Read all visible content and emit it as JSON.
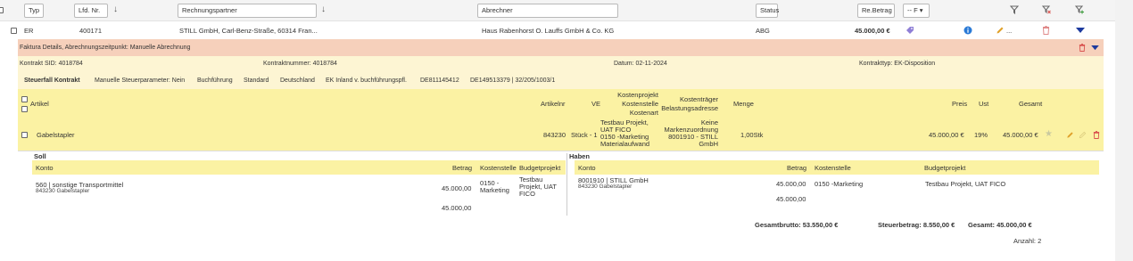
{
  "filters": {
    "typ": "Typ",
    "lfd_nr": "Lfd. Nr.",
    "rechnungspartner": "Rechnungspartner",
    "abrechner": "Abrechner",
    "status": "Status",
    "re_betrag": "Re.Betrag",
    "select_value": "-- F"
  },
  "row": {
    "typ": "ER",
    "lfd_nr": "400171",
    "rechnungspartner": "STILL GmbH, Carl-Benz-Straße, 60314 Fran...",
    "abrechner": "Haus Rabenhorst O. Lauffs GmbH & Co. KG",
    "status": "ABG",
    "betrag": "45.000,00 €",
    "more": "..."
  },
  "detail": {
    "header": "Faktura Details, Abrechnungszeitpunkt: Manuelle Abrechnung",
    "kontrakt_sid": "Kontrakt SID: 4018784",
    "kontraktnummer": "Kontraktnummer: 4018784",
    "datum": "Datum: 02-11-2024",
    "kontrakttyp": "Kontrakttyp: EK-Disposition",
    "steuerfall": "Steuerfall Kontrakt",
    "steuerparameter": "Manuelle Steuerparameter: Nein",
    "buchfuehrung": "Buchführung",
    "standard": "Standard",
    "land": "Deutschland",
    "ek_inland": "EK Inland v. buchführungspfl.",
    "ust_id": "DE811145412",
    "ust_id2": "DE149513379 | 32/205/1003/1"
  },
  "article_table": {
    "headers": {
      "artikel": "Artikel",
      "artikelnr": "Artikelnr",
      "ve": "VE",
      "kostenprojekt": "Kostenprojekt",
      "kostenstelle": "Kostenstelle",
      "kostenart": "Kostenart",
      "kostentraeger": "Kostenträger",
      "belastungsadresse": "Belastungsadresse",
      "menge": "Menge",
      "preis": "Preis",
      "ust": "Ust",
      "gesamt": "Gesamt"
    },
    "row": {
      "artikel": "Gabelstapler",
      "artikelnr": "843230",
      "ve": "Stück - 1",
      "kosten_line1": "Testbau Projekt,",
      "kosten_line2": "UAT FICO",
      "kosten_line3": "0150 -Marketing",
      "kosten_line4": "Materialaufwand",
      "traeger_line1": "Keine",
      "traeger_line2": "Markenzuordnung",
      "traeger_line3": "8001910 - STILL",
      "traeger_line4": "GmbH",
      "menge": "1,00Stk",
      "preis": "45.000,00 €",
      "ust": "19%",
      "gesamt": "45.000,00 €"
    }
  },
  "soll": {
    "title": "Soll",
    "headers": {
      "konto": "Konto",
      "betrag": "Betrag",
      "kostenstelle": "Kostenstelle",
      "budgetprojekt": "Budgetprojekt"
    },
    "konto": "560 | sonstige Transportmittel",
    "konto_sub": "843230 Gabelstapler",
    "betrag": "45.000,00",
    "kostenstelle_l1": "0150 -",
    "kostenstelle_l2": "Marketing",
    "budget_l1": "Testbau",
    "budget_l2": "Projekt, UAT",
    "budget_l3": "FICO",
    "summe": "45.000,00"
  },
  "haben": {
    "title": "Haben",
    "headers": {
      "konto": "Konto",
      "betrag": "Betrag",
      "kostenstelle": "Kostenstelle",
      "budgetprojekt": "Budgetprojekt"
    },
    "konto": "8001910 | STILL GmbH",
    "konto_sub": "843230 Gabelstapler",
    "betrag": "45.000,00",
    "kostenstelle": "0150 -Marketing",
    "budget": "Testbau Projekt, UAT FICO",
    "summe": "45.000,00"
  },
  "totals": {
    "brutto": "Gesamtbrutto: 53.550,00 €",
    "steuer": "Steuerbetrag: 8.550,00 €",
    "gesamt": "Gesamt: 45.000,00 €",
    "anzahl": "Anzahl: 2"
  },
  "colors": {
    "orange": "#f6d0bb",
    "light_yellow": "#fdf5d3",
    "yellow": "#fbf2a3",
    "blue_info": "#2a7ad6",
    "red": "#d9534f",
    "dark_blue": "#1d3a9e"
  }
}
